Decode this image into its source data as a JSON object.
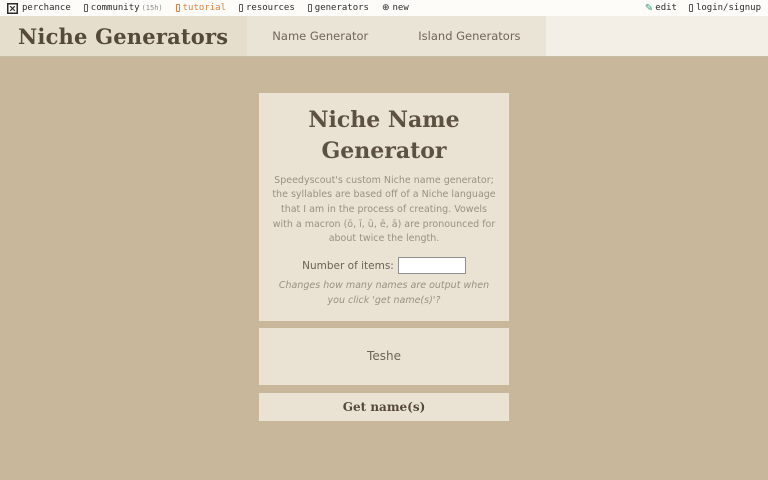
{
  "topbar": {
    "brand": "perchance",
    "community_label": "community",
    "community_badge": "(15h)",
    "tutorial_label": "tutorial",
    "resources_label": "resources",
    "generators_label": "generators",
    "new_label": "new",
    "new_glyph": "⊕",
    "edit_glyph": "✎",
    "edit_label": "edit",
    "login_label": "login/signup"
  },
  "header": {
    "title": "Niche Generators",
    "tabs": [
      {
        "label": "Name Generator"
      },
      {
        "label": "Island Generators"
      }
    ]
  },
  "generator": {
    "title": "Niche Name Generator",
    "description": "Speedyscout's custom Niche name generator; the syllables are based off of a Niche language that I am in the process of creating. Vowels with a macron (ō, ī, ū, ē, ā) are pronounced for about twice the length.",
    "items_label": "Number of items:",
    "items_value": "",
    "note": "Changes how many names are output when you click 'get name(s)'?",
    "output": "Teshe",
    "button_label": "Get name(s)"
  },
  "colors": {
    "page_background": "#c9b79c",
    "topbar_background": "#fdfcf9",
    "header_background": "#f3efe6",
    "title_block_background": "#e5decd",
    "tab_block_background": "#eae4d6",
    "card_background": "#eae3d4",
    "accent_orange": "#e0823f",
    "edit_green": "#2f9e68",
    "heading_brown": "#55493a"
  }
}
